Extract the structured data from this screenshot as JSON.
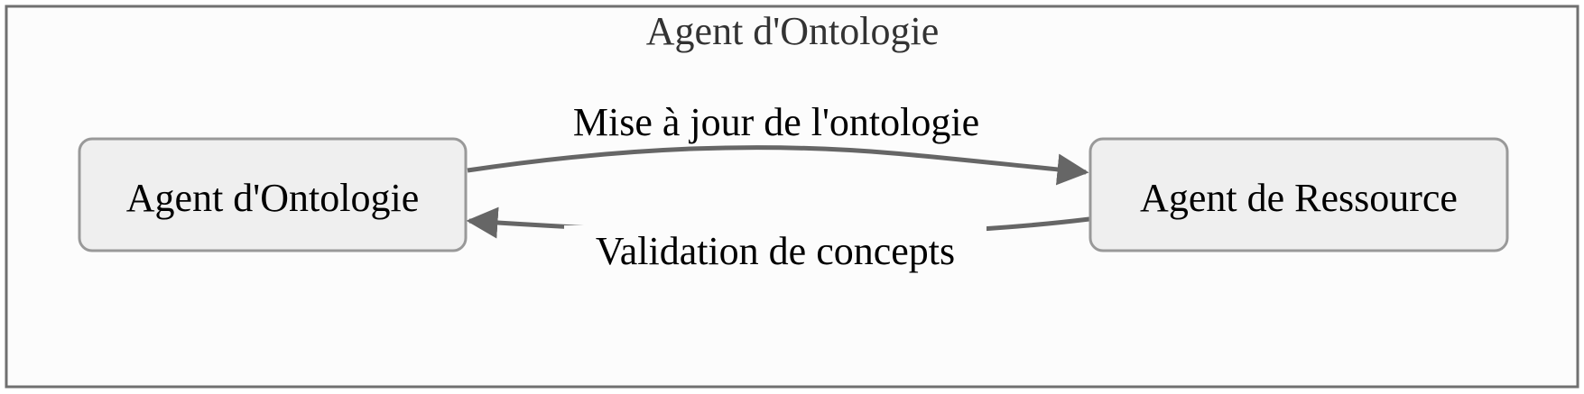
{
  "cluster": {
    "title": "Agent d'Ontologie"
  },
  "nodes": {
    "left": {
      "label": "Agent d'Ontologie"
    },
    "right": {
      "label": "Agent de Ressource"
    }
  },
  "edges": {
    "update": {
      "label": "Mise à jour de l'ontologie",
      "from": "left",
      "to": "right"
    },
    "validation": {
      "label": "Validation de concepts",
      "from": "right",
      "to": "left"
    }
  },
  "colors": {
    "background": "#ffffff",
    "cluster_fill": "#fcfcfc",
    "cluster_border": "#707070",
    "node_fill": "#efefef",
    "node_border": "#999999",
    "edge": "#666666",
    "text": "#000000",
    "title_text": "#333333"
  }
}
